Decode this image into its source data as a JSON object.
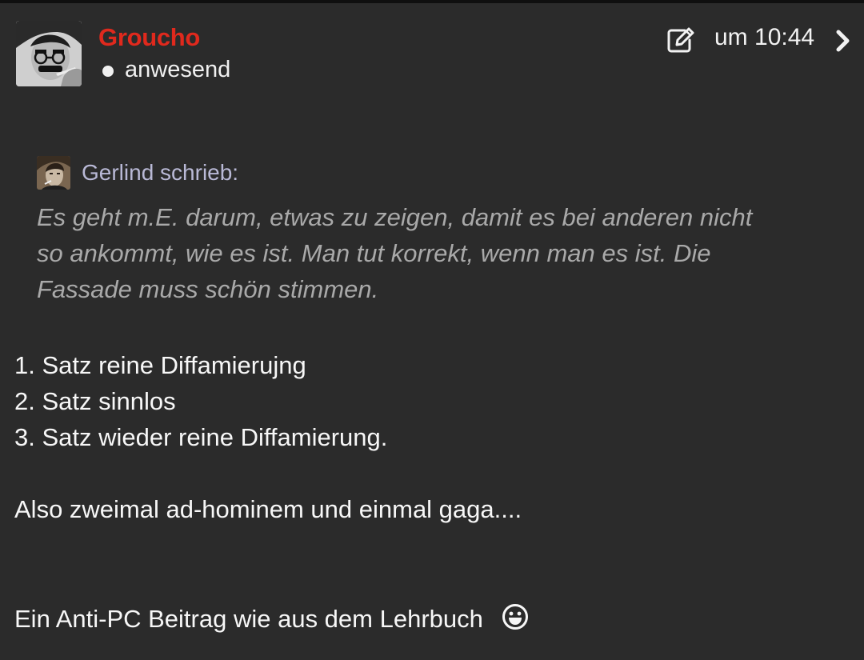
{
  "post": {
    "author": "Groucho",
    "status": "anwesend",
    "time": "um 10:44"
  },
  "quote": {
    "author": "Gerlind schrieb:",
    "lines": [
      "Es geht m.E. darum, etwas zu zeigen, damit es bei anderen nicht",
      "so ankommt, wie es ist. Man tut korrekt, wenn man es ist. Die",
      "Fassade muss schön stimmen."
    ]
  },
  "body": {
    "list": [
      "1. Satz reine Diffamierujng",
      "2. Satz sinnlos",
      "3. Satz wieder reine Diffamierung."
    ],
    "summary": "Also zweimal ad-hominem und einmal gaga....",
    "closing": "Ein Anti-PC Beitrag wie aus dem Lehrbuch"
  },
  "icons": {
    "edit": "edit-icon",
    "next": "chevron-right-icon",
    "smiley": "smiley-icon"
  },
  "colors": {
    "background": "#2b2b2b",
    "author_name": "#e0291d",
    "quote_author": "#b9b9d6",
    "quote_text": "#a9a9a9",
    "body_text": "#f7f7f7"
  }
}
